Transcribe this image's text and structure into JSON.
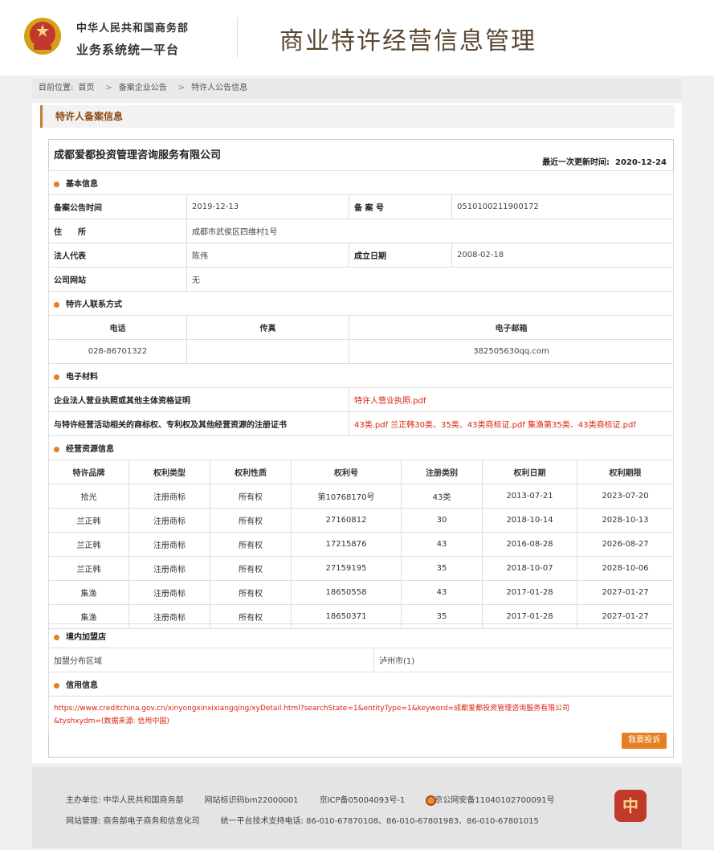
{
  "header": {
    "org_line1": "中华人民共和国商务部",
    "org_line2": "业务系统统一平台",
    "site_title": "商业特许经营信息管理"
  },
  "breadcrumb": {
    "prefix": "目前位置:",
    "items": [
      "首页",
      "备案企业公告",
      "特许人公告信息"
    ],
    "sep": ">"
  },
  "panel": {
    "title": "特许人备案信息"
  },
  "company": {
    "name": "成都爱都投资管理咨询服务有限公司",
    "update_label": "最近一次更新时间:",
    "update_value": "2020-12-24"
  },
  "basic": {
    "section": "基本信息",
    "publish_time_label": "备案公告时间",
    "publish_time": "2019-12-13",
    "record_no_label": "备 案 号",
    "record_no": "0510100211900172",
    "address_label": "住　　所",
    "address": "成都市武侯区四维村1号",
    "legal_rep_label": "法人代表",
    "legal_rep": "陈伟",
    "founded_label": "成立日期",
    "founded": "2008-02-18",
    "website_label": "公司网站",
    "website": "无"
  },
  "contact": {
    "section": "特许人联系方式",
    "headers": [
      "电话",
      "传真",
      "电子邮箱"
    ],
    "phone": "028-86701322",
    "fax": "",
    "email": "382505630qq.com"
  },
  "materials": {
    "section": "电子材料",
    "row1_label": "企业法人营业执照或其他主体资格证明",
    "row1_value": "特许人营业执照.pdf",
    "row2_label": "与特许经营活动相关的商标权、专利权及其他经营资源的注册证书",
    "row2_value": "43类.pdf 兰正韩30类、35类、43类商标证.pdf 集渔第35类、43类商标证.pdf"
  },
  "resources": {
    "section": "经营资源信息",
    "headers": [
      "特许品牌",
      "权利类型",
      "权利性质",
      "权利号",
      "注册类别",
      "权利日期",
      "权利期限"
    ],
    "rows": [
      [
        "拾光",
        "注册商标",
        "所有权",
        "第10768170号",
        "43类",
        "2013-07-21",
        "2023-07-20"
      ],
      [
        "兰正韩",
        "注册商标",
        "所有权",
        "27160812",
        "30",
        "2018-10-14",
        "2028-10-13"
      ],
      [
        "兰正韩",
        "注册商标",
        "所有权",
        "17215876",
        "43",
        "2016-08-28",
        "2026-08-27"
      ],
      [
        "兰正韩",
        "注册商标",
        "所有权",
        "27159195",
        "35",
        "2018-10-07",
        "2028-10-06"
      ],
      [
        "集渔",
        "注册商标",
        "所有权",
        "18650558",
        "43",
        "2017-01-28",
        "2027-01-27"
      ],
      [
        "集渔",
        "注册商标",
        "所有权",
        "18650371",
        "35",
        "2017-01-28",
        "2027-01-27"
      ]
    ]
  },
  "stores": {
    "section": "境内加盟店",
    "region_label": "加盟分布区域",
    "region_value": "泸州市(1)"
  },
  "credit": {
    "section": "信用信息",
    "line1": "https://www.creditchina.gov.cn/xinyongxinxixiangqing/xyDetail.html?searchState=1&entityType=1&keyword=成都爱都投资管理咨询服务有限公司",
    "line2": "&tyshxydm=(数据来源: 信用中国)"
  },
  "report_button": "我要投诉",
  "footer": {
    "sponsor": "主办单位: 中华人民共和国商务部",
    "site_id": "网站标识码bm22000001",
    "icp": "京ICP备05004093号-1",
    "police": "京公网安备11040102700091号",
    "maintainer": "网站管理: 商务部电子商务和信息化司",
    "support": "统一平台技术支持电话: 86-010-67870108、86-010-67801983、86-010-67801015",
    "badge_char": "中"
  },
  "colors": {
    "accent": "#e67e22",
    "link_red": "#d9230f",
    "title_brown": "#5a4630"
  }
}
